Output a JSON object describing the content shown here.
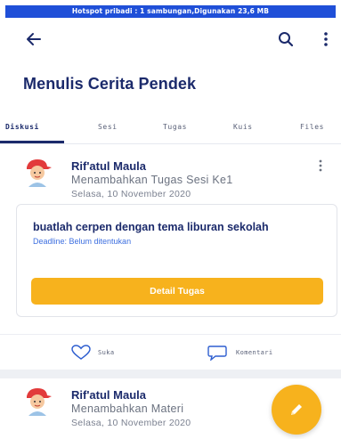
{
  "status_bar": {
    "hotspot_text": "Hotspot pribadi : 1 sambungan,Digunakan 23,6 MB"
  },
  "appbar": {
    "back_icon": "arrow-left-icon",
    "search_icon": "search-icon",
    "menu_icon": "kebab-menu-icon"
  },
  "course": {
    "title": "Menulis Cerita Pendek"
  },
  "tabs": [
    {
      "label": "Diskusi",
      "active": true
    },
    {
      "label": "Sesi",
      "active": false
    },
    {
      "label": "Tugas",
      "active": false
    },
    {
      "label": "Kuis",
      "active": false
    },
    {
      "label": "Files",
      "active": false
    }
  ],
  "posts": [
    {
      "author": "Rif'atul Maula",
      "action": "Menambahkan Tugas Sesi Ke1",
      "date": "Selasa, 10 November 2020",
      "task": {
        "title": "buatlah cerpen dengan tema liburan sekolah",
        "deadline": "Deadline: Belum ditentukan",
        "button_label": "Detail Tugas"
      },
      "reactions": {
        "like_label": "Suka",
        "comment_label": "Komentari"
      }
    },
    {
      "author": "Rif'atul Maula",
      "action": "Menambahkan Materi",
      "date": "Selasa, 10 November 2020"
    }
  ],
  "colors": {
    "primary": "#1b2a6b",
    "accent": "#f7b21d",
    "link": "#3d6fe0",
    "hotspot_bar": "#1f4fd8"
  },
  "fab": {
    "icon": "pencil-icon"
  }
}
